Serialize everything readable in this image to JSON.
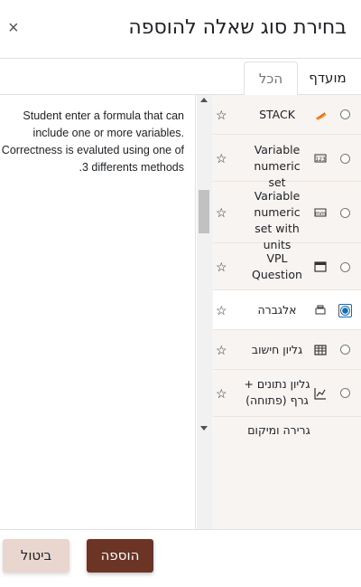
{
  "dialog": {
    "title": "בחירת סוג שאלה להוספה",
    "close_label": "×"
  },
  "tabs": [
    {
      "label": "מועדף"
    },
    {
      "label": "הכל"
    }
  ],
  "description": "Student enter a formula that can include one or more variables. Correctness is evaluted using one of 3 differents methods.",
  "question_types": [
    {
      "name": "STACK",
      "icon": "stack-icon",
      "selected": false
    },
    {
      "name": "Variable numeric set",
      "icon": "variable-numeric-icon",
      "selected": false
    },
    {
      "name": "Variable numeric set with units",
      "icon": "variable-units-icon",
      "selected": false
    },
    {
      "name": "VPL Question",
      "icon": "vpl-icon",
      "selected": false
    },
    {
      "name": "אלגברה",
      "icon": "algebra-icon",
      "selected": true
    },
    {
      "name": "גליון חישוב",
      "icon": "spreadsheet-icon",
      "selected": false
    },
    {
      "name": "גליון נתונים + גרף (פתוחה)",
      "icon": "chart-icon",
      "selected": false
    },
    {
      "name": "גרירה ומיקום",
      "icon": "drag-drop-icon",
      "selected": false
    }
  ],
  "buttons": {
    "add": "הוספה",
    "cancel": "ביטול"
  },
  "colors": {
    "primary": "#6b3425",
    "secondary": "#e9d7cf",
    "list_background": "#f8f4f2",
    "radio_selected": "#0f6cbf"
  }
}
